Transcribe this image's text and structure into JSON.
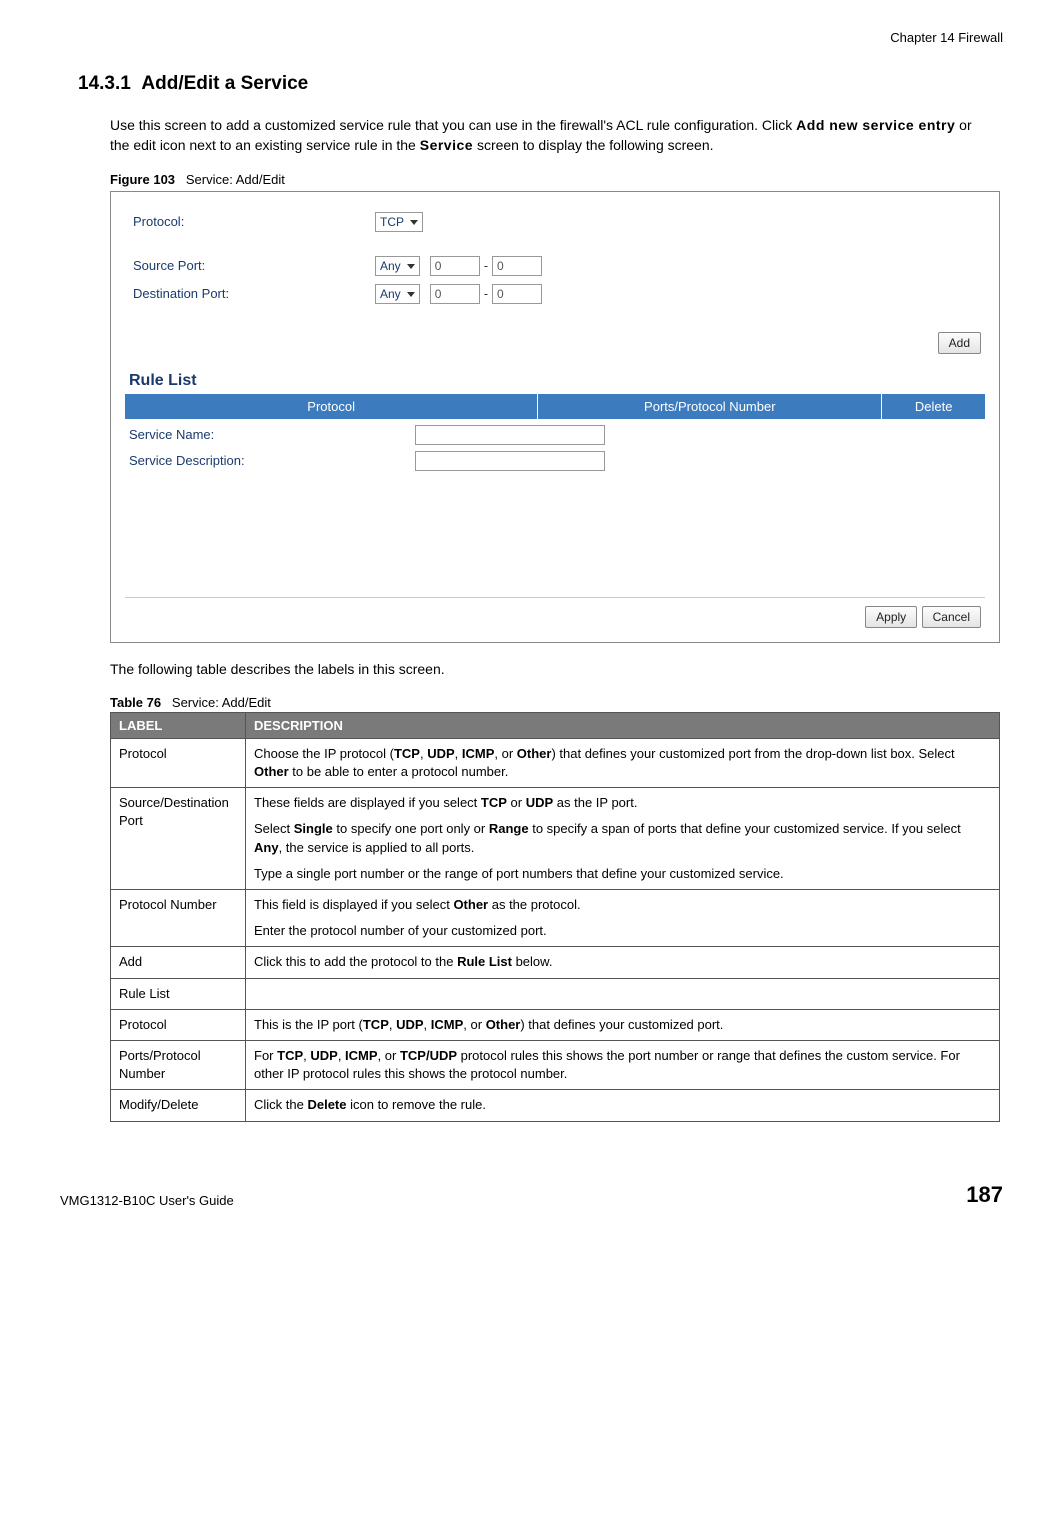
{
  "header": {
    "chapter": "Chapter 14 Firewall"
  },
  "section": {
    "number": "14.3.1",
    "title": "Add/Edit a Service",
    "intro_a": "Use this screen to add a customized service rule that you can use in the firewall's ACL rule configuration. Click ",
    "intro_bold1": "Add new service entry",
    "intro_b": " or the edit icon next to an existing service rule in the ",
    "intro_bold2": "Service",
    "intro_c": " screen to display the following screen."
  },
  "figure": {
    "num": "Figure 103",
    "caption": "Service: Add/Edit"
  },
  "form": {
    "protocol_label": "Protocol:",
    "protocol_value": "TCP",
    "src_label": "Source Port:",
    "dst_label": "Destination Port:",
    "port_mode": "Any",
    "port_from": "0",
    "port_to": "0",
    "add_btn": "Add",
    "rule_list_title": "Rule List",
    "col_protocol": "Protocol",
    "col_ports": "Ports/Protocol Number",
    "col_delete": "Delete",
    "svc_name_label": "Service Name:",
    "svc_desc_label": "Service Description:",
    "apply_btn": "Apply",
    "cancel_btn": "Cancel"
  },
  "after_figure": "The following table describes the labels in this screen.",
  "table": {
    "num": "Table 76",
    "caption": "Service: Add/Edit",
    "h_label": "LABEL",
    "h_desc": "DESCRIPTION",
    "rows": {
      "r0": {
        "label": "Protocol",
        "d_a": "Choose the IP protocol (",
        "d_b": "TCP",
        "d_c": ", ",
        "d_d": "UDP",
        "d_e": ", ",
        "d_f": "ICMP",
        "d_g": ", or ",
        "d_h": "Other",
        "d_i": ") that defines your customized port from the drop-down list box. Select ",
        "d_j": "Other",
        "d_k": " to be able to enter a protocol number."
      },
      "r1": {
        "label": "Source/Destination Port",
        "p1a": "These fields are displayed if you select ",
        "p1b": "TCP",
        "p1c": " or ",
        "p1d": "UDP",
        "p1e": " as the IP port.",
        "p2a": "Select ",
        "p2b": "Single",
        "p2c": " to specify one port only or ",
        "p2d": "Range",
        "p2e": " to specify a span of ports that define your customized service. If you select ",
        "p2f": "Any",
        "p2g": ", the service is applied to all ports.",
        "p3": "Type a single port number or the range of port numbers that define your customized service."
      },
      "r2": {
        "label": "Protocol Number",
        "p1a": "This field is displayed if you select ",
        "p1b": "Other",
        "p1c": " as the protocol.",
        "p2": "Enter the protocol number of your customized port."
      },
      "r3": {
        "label": "Add",
        "d_a": "Click this to add the protocol to the ",
        "d_b": "Rule List",
        "d_c": " below."
      },
      "r4": {
        "label": "Rule List",
        "desc": ""
      },
      "r5": {
        "label": "Protocol",
        "d_a": "This is the IP port (",
        "d_b": "TCP",
        "d_c": ", ",
        "d_d": "UDP",
        "d_e": ", ",
        "d_f": "ICMP",
        "d_g": ", or ",
        "d_h": "Other",
        "d_i": ") that defines your customized port."
      },
      "r6": {
        "label": "Ports/Protocol Number",
        "d_a": "For ",
        "d_b": "TCP",
        "d_c": ", ",
        "d_d": "UDP",
        "d_e": ", ",
        "d_f": "ICMP",
        "d_g": ", or ",
        "d_h": "TCP/UDP",
        "d_i": " protocol rules this shows the port number or range that defines the custom service. For other IP protocol rules this shows the protocol number."
      },
      "r7": {
        "label": "Modify/Delete",
        "d_a": "Click the ",
        "d_b": "Delete",
        "d_c": " icon to remove the rule."
      }
    }
  },
  "footer": {
    "guide": "VMG1312-B10C User's Guide",
    "page": "187"
  }
}
